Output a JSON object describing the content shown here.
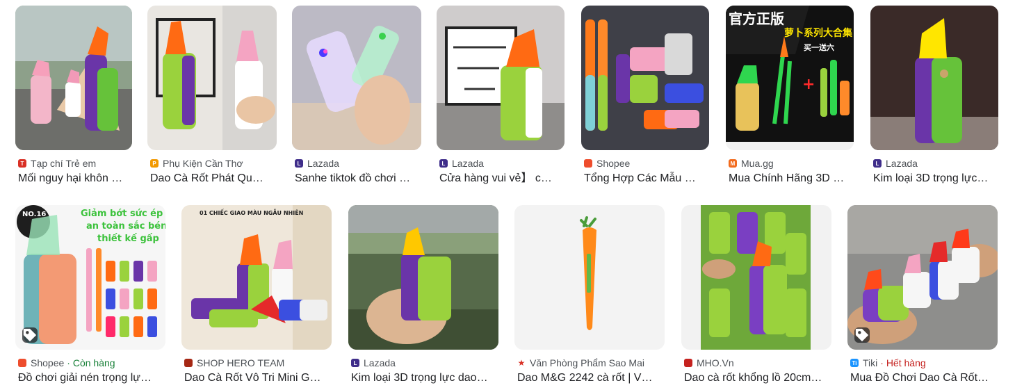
{
  "results": [
    {
      "source": "Tạp chí Trẻ em",
      "title": "Mối nguy hại khôn …",
      "extra": "",
      "favicon_color": "#d93025",
      "favicon_glyph": "T",
      "tag_icon": false
    },
    {
      "source": "Phụ Kiện Cần Thơ",
      "title": "Dao Cà Rốt Phát Qu…",
      "extra": "",
      "favicon_color": "#f29900",
      "favicon_glyph": "P",
      "tag_icon": false
    },
    {
      "source": "Lazada",
      "title": "Sanhe tiktok đồ chơi …",
      "extra": "",
      "favicon_color": "#3f2d8a",
      "favicon_glyph": "L",
      "tag_icon": false
    },
    {
      "source": "Lazada",
      "title": "Cửa hàng vui vẻ】 c…",
      "extra": "",
      "favicon_color": "#3f2d8a",
      "favicon_glyph": "L",
      "tag_icon": false
    },
    {
      "source": "Shopee",
      "title": "Tổng Hợp Các Mẫu …",
      "extra": "",
      "favicon_color": "#ee4d2d",
      "favicon_glyph": "",
      "tag_icon": false
    },
    {
      "source": "Mua.gg",
      "title": "Mua Chính Hãng 3D …",
      "extra": "",
      "favicon_color": "#f26b1d",
      "favicon_glyph": "M",
      "tag_icon": false
    },
    {
      "source": "Lazada",
      "title": "Kim loại 3D trọng lực…",
      "extra": "",
      "favicon_color": "#3f2d8a",
      "favicon_glyph": "L",
      "tag_icon": false
    },
    {
      "source": "Shopee",
      "title": "Đồ chơi giải nén trọng lự…",
      "extra": "· Còn hàng",
      "extra_color": "#188038",
      "favicon_color": "#ee4d2d",
      "favicon_glyph": "",
      "tag_icon": true
    },
    {
      "source": "SHOP HERO TEAM",
      "title": "Dao Cà Rốt Vô Tri Mini G…",
      "extra": "",
      "favicon_color": "#a52714",
      "favicon_glyph": "",
      "tag_icon": false
    },
    {
      "source": "Lazada",
      "title": "Kim loại 3D trọng lực dao…",
      "extra": "",
      "favicon_color": "#3f2d8a",
      "favicon_glyph": "L",
      "tag_icon": false
    },
    {
      "source": "Văn Phòng Phẩm Sao Mai",
      "title": "Dao M&G 2242 cà rốt | V…",
      "extra": "",
      "favicon_color": "#d93025",
      "favicon_glyph": "★",
      "tag_icon": false
    },
    {
      "source": "MHO.Vn",
      "title": "Dao cà rốt khổng lồ 20cm…",
      "extra": "",
      "favicon_color": "#c5221f",
      "favicon_glyph": "",
      "tag_icon": false
    },
    {
      "source": "Tiki",
      "title": "Mua Đồ Chơi Dao Cà Rốt…",
      "extra": "· Hết hàng",
      "extra_color": "#c5221f",
      "favicon_color": "#1a94ff",
      "favicon_glyph": "Ti",
      "tag_icon": true
    }
  ],
  "image_text": {
    "r4_banner_line1": "官方正版",
    "r4_banner_line2": "萝卜系列大合集",
    "r4_banner_line3": "买一送六",
    "r1_banner_line1": "Giảm bớt sức ép",
    "r1_banner_line2": "an toàn sắc bén",
    "r1_banner_line3": "thiết kế gấp",
    "r1_badge": "NO.16",
    "r2_caption": "01 CHIẾC GIAO MÀU NGẪU NHIÊN"
  }
}
